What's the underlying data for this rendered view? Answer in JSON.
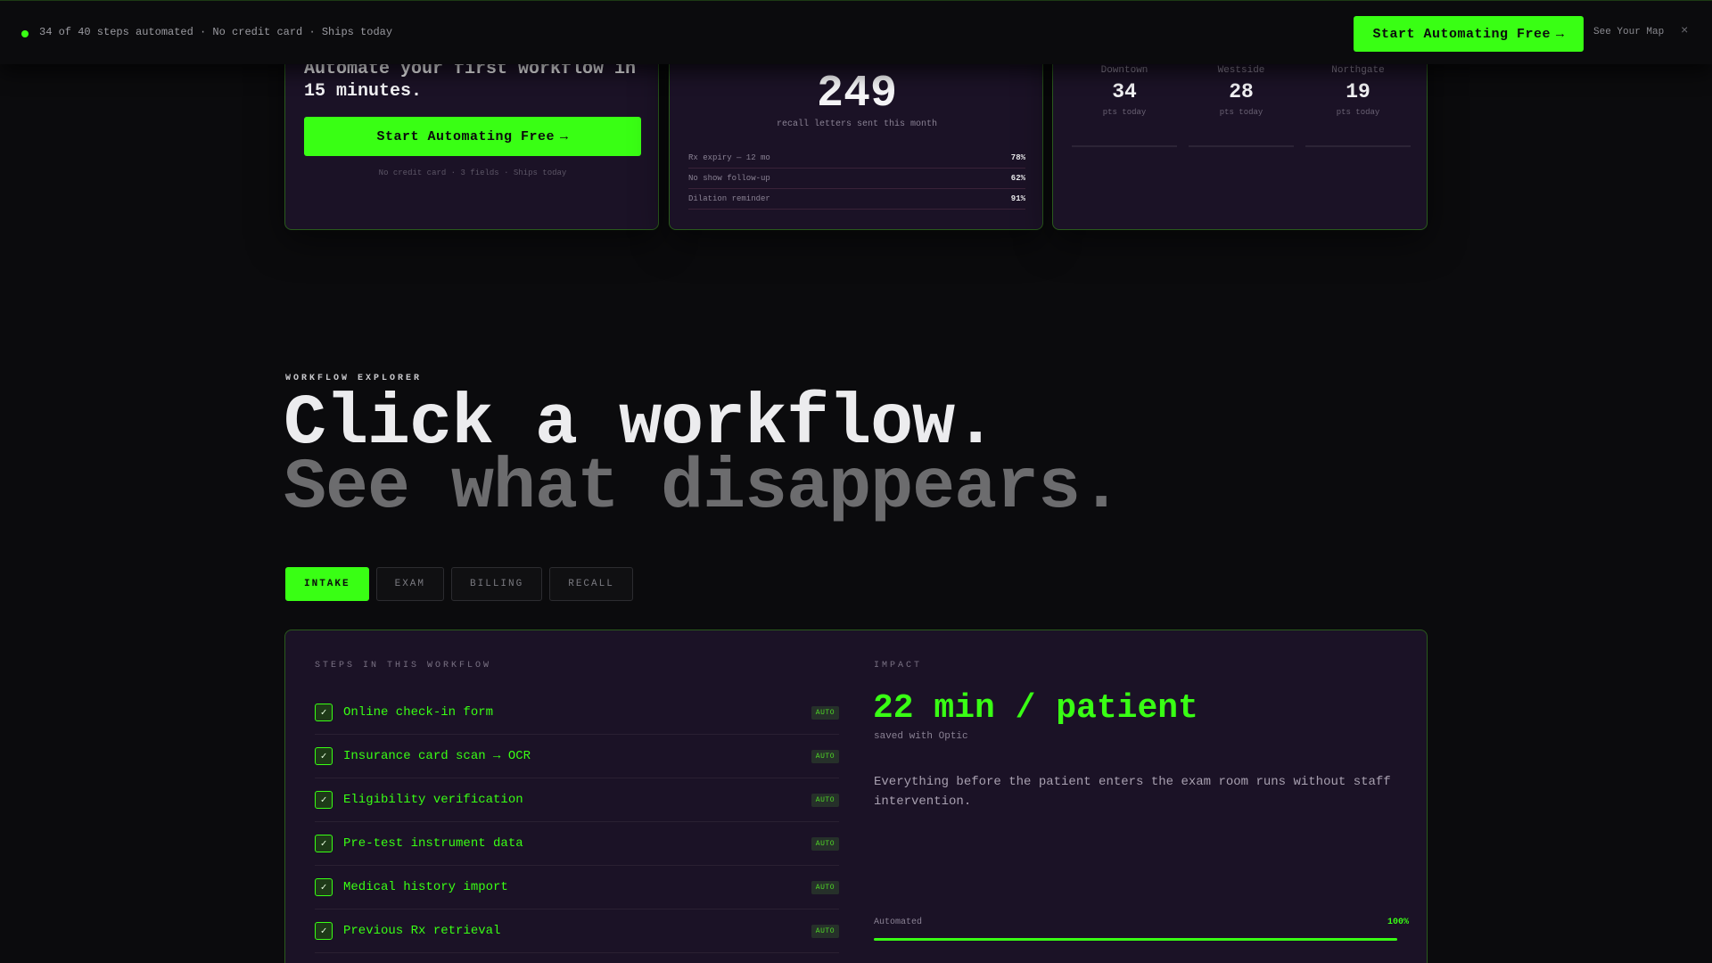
{
  "topbar": {
    "status": "34 of 40 steps automated · No credit card · Ships today",
    "cta_label": "Start Automating Free",
    "cta_arrow": "→",
    "map_link": "See Your Map",
    "close_glyph": "×"
  },
  "signup_card": {
    "headline": "Automate your first workflow in 15 minutes.",
    "button_label": "Start Automating Free",
    "button_arrow": "→",
    "fine_print": "No credit card · 3 fields · Ships today"
  },
  "recall_card": {
    "count": "249",
    "caption": "recall letters sent this month",
    "rows": [
      {
        "label": "Rx expiry — 12 mo",
        "pct": "78%"
      },
      {
        "label": "No show follow-up",
        "pct": "62%"
      },
      {
        "label": "Dilation reminder",
        "pct": "91%"
      }
    ]
  },
  "locations_card": {
    "locations": [
      {
        "name": "Downtown",
        "count": "34",
        "unit": "pts today"
      },
      {
        "name": "Westside",
        "count": "28",
        "unit": "pts today"
      },
      {
        "name": "Northgate",
        "count": "19",
        "unit": "pts today"
      }
    ]
  },
  "explorer": {
    "eyebrow": "WORKFLOW EXPLORER",
    "title_line1": "Click a workflow.",
    "title_line2": "See what disappears.",
    "tabs": [
      "INTAKE",
      "EXAM",
      "BILLING",
      "RECALL"
    ],
    "active_tab": "INTAKE",
    "steps_label": "STEPS IN THIS WORKFLOW",
    "impact_label": "IMPACT",
    "steps": [
      {
        "text": "Online check-in form",
        "badge": "AUTO"
      },
      {
        "text": "Insurance card scan → OCR",
        "badge": "AUTO"
      },
      {
        "text": "Eligibility verification",
        "badge": "AUTO"
      },
      {
        "text": "Pre-test instrument data",
        "badge": "AUTO"
      },
      {
        "text": "Medical history import",
        "badge": "AUTO"
      },
      {
        "text": "Previous Rx retrieval",
        "badge": "AUTO"
      }
    ],
    "check_glyph": "✓",
    "impact_value": "22 min / patient",
    "impact_sub": "saved with Optic",
    "impact_desc": "Everything before the patient enters the exam room runs without staff intervention.",
    "automated_label": "Automated",
    "automated_pct": "100%",
    "automated_fraction": 1.0
  },
  "colors": {
    "accent": "#39ff14",
    "background": "#0b0b0d",
    "card": "#1b1226"
  }
}
